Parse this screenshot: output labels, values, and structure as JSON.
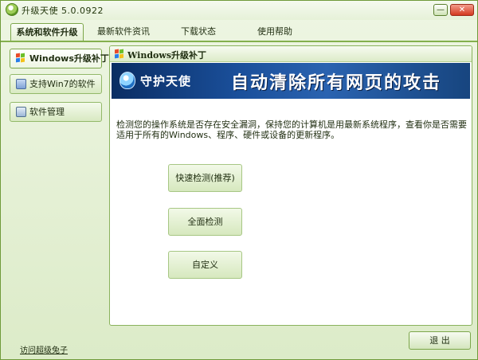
{
  "window": {
    "title": "升级天使 5.0.0922",
    "minimize_label": "—",
    "close_label": "✕"
  },
  "tabs": [
    {
      "label": "系统和软件升级",
      "active": true
    },
    {
      "label": "最新软件资讯",
      "active": false
    },
    {
      "label": "下载状态",
      "active": false
    },
    {
      "label": "使用帮助",
      "active": false
    }
  ],
  "sidebar": {
    "items": [
      {
        "label": "Windows升级补丁",
        "icon": "windows-flag-icon",
        "active": true
      },
      {
        "label": "支持Win7的软件",
        "icon": "software-box-icon",
        "active": false
      },
      {
        "label": "软件管理",
        "icon": "manage-icon",
        "active": false
      }
    ]
  },
  "panel": {
    "title": "Windows升级补丁",
    "banner_left": "守护天使",
    "banner_right": "自动清除所有网页的攻击",
    "description": "检测您的操作系统是否存在安全漏洞，保持您的计算机是用最新系统程序，查看你是否需要适用于所有的Windows、程序、硬件或设备的更新程序。",
    "buttons": [
      {
        "label": "快速检测(推荐)"
      },
      {
        "label": "全面检测"
      },
      {
        "label": "自定义"
      }
    ]
  },
  "footer": {
    "link": "访问超级兔子",
    "exit_label": "退 出"
  },
  "colors": {
    "accent_green": "#7ca64a",
    "banner_blue": "#1a4f9a"
  }
}
